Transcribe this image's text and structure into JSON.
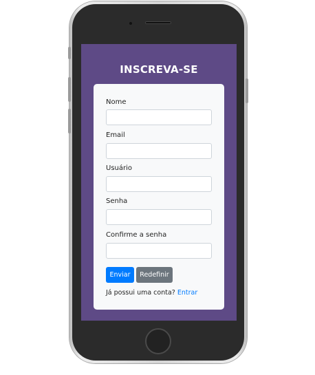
{
  "form": {
    "title": "INSCREVA-SE",
    "fields": [
      {
        "label": "Nome",
        "value": "",
        "placeholder": ""
      },
      {
        "label": "Email",
        "value": "",
        "placeholder": ""
      },
      {
        "label": "Usuário",
        "value": "",
        "placeholder": ""
      },
      {
        "label": "Senha",
        "value": "",
        "placeholder": ""
      },
      {
        "label": "Confirme a senha",
        "value": "",
        "placeholder": ""
      }
    ],
    "submit_label": "Enviar",
    "reset_label": "Redefinir",
    "login_prompt": "Já possui uma conta?",
    "login_link": "Entrar"
  },
  "colors": {
    "screen_background": "#5e4a86",
    "card_background": "#f8f9fa",
    "primary": "#007bff",
    "secondary": "#6c757d"
  }
}
